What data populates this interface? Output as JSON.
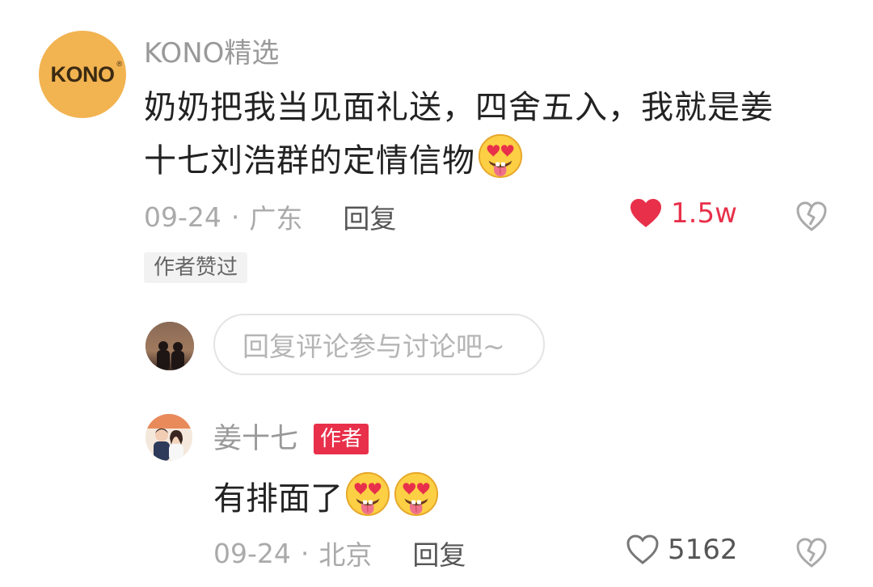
{
  "comment": {
    "avatar_logo": "KONO",
    "username": "KONO精选",
    "text_line1": "奶奶把我当见面礼送，四舍五入，我就是姜",
    "text_line2": "十七刘浩群的定情信物",
    "text_emoji": "heart-eyes-tongue-emoji",
    "date": "09-24",
    "separator": "·",
    "location": "广东",
    "reply_label": "回复",
    "like_count": "1.5w",
    "liked": true,
    "author_liked_badge": "作者赞过"
  },
  "reply_box": {
    "placeholder": "回复评论参与讨论吧~"
  },
  "author_reply": {
    "username": "姜十七",
    "badge": "作者",
    "text": "有排面了",
    "emojis": [
      "heart-eyes-tongue-emoji",
      "heart-eyes-tongue-emoji"
    ],
    "date": "09-24",
    "separator": "·",
    "location": "北京",
    "reply_label": "回复",
    "like_count": "5162",
    "liked": false
  },
  "colors": {
    "like_active": "#e8304a",
    "author_badge": "#e8304a",
    "avatar_kono": "#f2b351",
    "muted_text": "#999999"
  },
  "icons": {
    "like_active": "heart-filled-icon",
    "like_inactive": "heart-outline-icon",
    "dislike": "broken-heart-icon"
  }
}
